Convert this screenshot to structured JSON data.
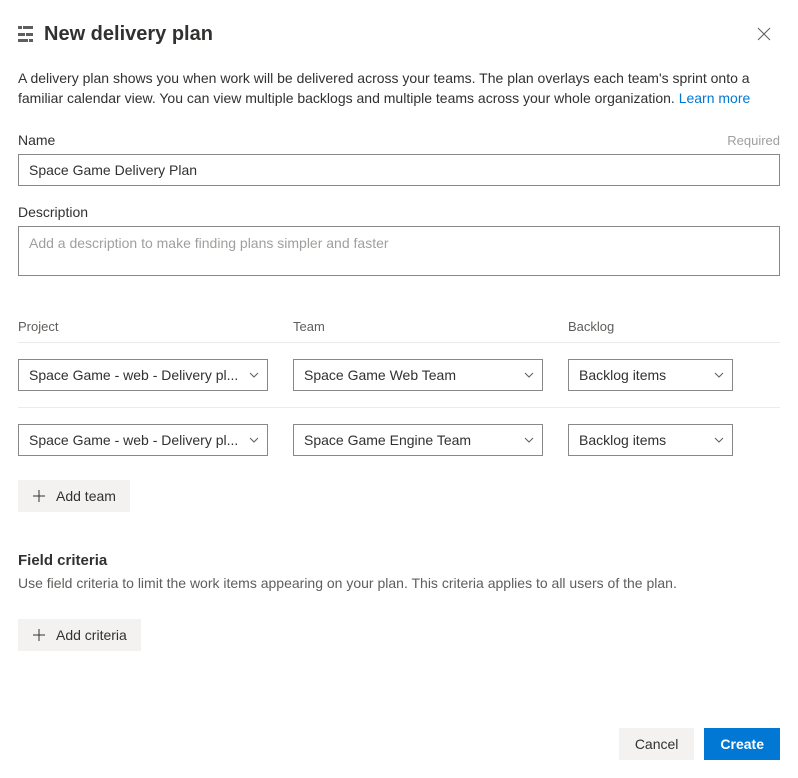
{
  "header": {
    "title": "New delivery plan"
  },
  "intro": {
    "text": "A delivery plan shows you when work will be delivered across your teams. The plan overlays each team's sprint onto a familiar calendar view. You can view multiple backlogs and multiple teams across your whole organization. ",
    "learn_more": "Learn more"
  },
  "name_field": {
    "label": "Name",
    "required": "Required",
    "value": "Space Game Delivery Plan"
  },
  "desc_field": {
    "label": "Description",
    "placeholder": "Add a description to make finding plans simpler and faster"
  },
  "teams": {
    "headers": {
      "project": "Project",
      "team": "Team",
      "backlog": "Backlog"
    },
    "rows": [
      {
        "project": "Space Game - web - Delivery pl...",
        "team": "Space Game Web Team",
        "backlog": "Backlog items"
      },
      {
        "project": "Space Game - web - Delivery pl...",
        "team": "Space Game Engine Team",
        "backlog": "Backlog items"
      }
    ],
    "add_team_label": "Add team"
  },
  "field_criteria": {
    "title": "Field criteria",
    "desc": "Use field criteria to limit the work items appearing on your plan. This criteria applies to all users of the plan.",
    "add_criteria_label": "Add criteria"
  },
  "footer": {
    "cancel": "Cancel",
    "create": "Create"
  }
}
